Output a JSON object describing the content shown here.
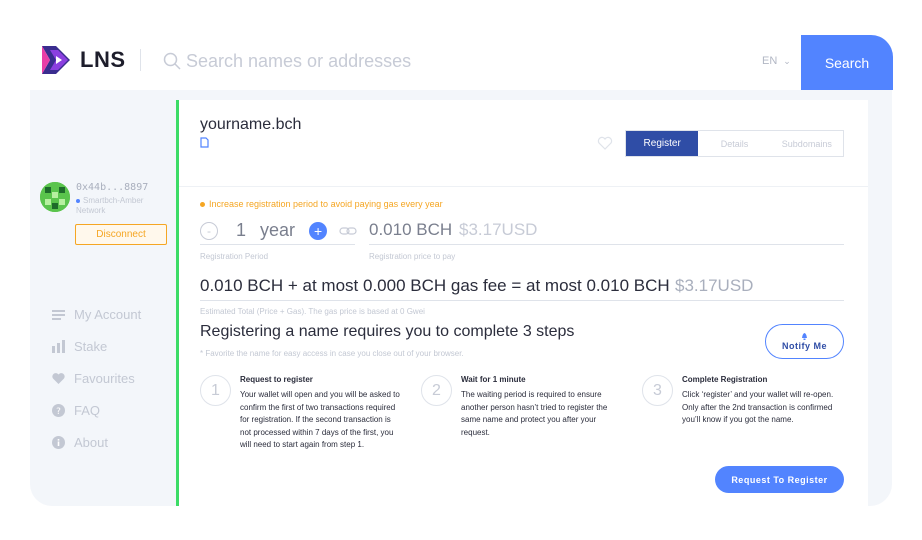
{
  "header": {
    "logo_text": "LNS",
    "search_placeholder": "Search names or addresses",
    "language": "EN",
    "search_button": "Search"
  },
  "account": {
    "address": "0x44b...8897",
    "network": "Smartbch-Amber Network",
    "disconnect": "Disconnect"
  },
  "sidebar": {
    "items": [
      {
        "label": "My Account",
        "icon": "list-icon"
      },
      {
        "label": "Stake",
        "icon": "bar-chart-icon"
      },
      {
        "label": "Favourites",
        "icon": "heart-icon"
      },
      {
        "label": "FAQ",
        "icon": "question-icon"
      },
      {
        "label": "About",
        "icon": "info-icon"
      }
    ]
  },
  "name": {
    "title": "yourname.bch"
  },
  "tabs": [
    {
      "label": "Register",
      "active": true
    },
    {
      "label": "Details",
      "active": false
    },
    {
      "label": "Subdomains",
      "active": false
    }
  ],
  "registration": {
    "warning": "Increase registration period to avoid paying gas every year",
    "period_value": "1",
    "period_unit": "year",
    "price": "0.010 BCH",
    "price_usd": "$3.17USD",
    "period_label": "Registration Period",
    "price_label": "Registration price to pay",
    "total": "0.010 BCH + at most 0.000 BCH gas fee = at most 0.010 BCH",
    "total_usd": "$3.17USD",
    "estimate_note": "Estimated Total (Price + Gas). The gas price is based at 0 Gwei"
  },
  "steps": {
    "title": "Registering a name requires you to complete 3 steps",
    "note": "* Favorite the name for easy access in case you close out of your browser.",
    "notify_button": "Notify Me",
    "items": [
      {
        "num": "1",
        "title": "Request to register",
        "body": "Your wallet will open and you will be asked to confirm the first of two transactions required for registration. If the second transaction is not processed within 7 days of the first, you will need to start again from step 1."
      },
      {
        "num": "2",
        "title": "Wait for 1 minute",
        "body": "The waiting period is required to ensure another person hasn’t tried to register the same name and protect you after your request."
      },
      {
        "num": "3",
        "title": "Complete Registration",
        "body": "Click ‘register’ and your wallet will re-open. Only after the 2nd transaction is confirmed you’ll know if you got the name."
      }
    ],
    "request_button": "Request To Register"
  },
  "colors": {
    "accent": "#5284ff",
    "tab_active": "#2f4da6",
    "warning": "#f5a623",
    "green_bar": "#3cdc66"
  }
}
